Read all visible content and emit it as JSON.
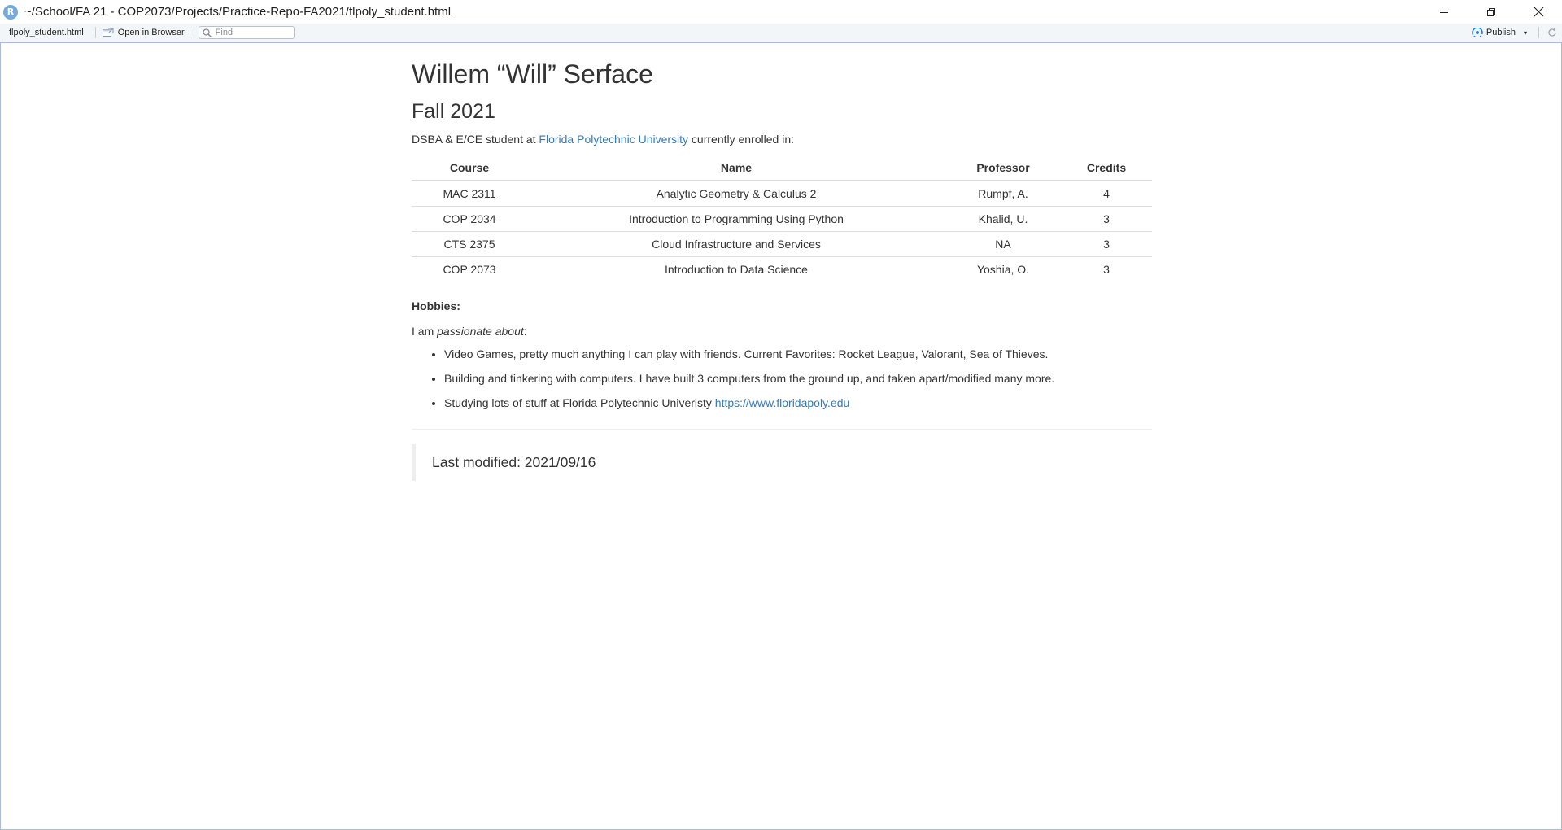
{
  "window": {
    "app_icon_letter": "R",
    "title": "~/School/FA 21 - COP2073/Projects/Practice-Repo-FA2021/flpoly_student.html",
    "controls": {
      "minimize_icon": "minimize-icon",
      "restore_icon": "restore-icon",
      "close_icon": "close-icon"
    }
  },
  "toolbar": {
    "filename": "flpoly_student.html",
    "open_in_browser_label": "Open in Browser",
    "find_placeholder": "Find",
    "publish_label": "Publish",
    "publish_caret": "▾"
  },
  "document": {
    "title": "Willem “Will” Serface",
    "subtitle": "Fall 2021",
    "intro_prefix": "DSBA & E/CE student at ",
    "intro_link": "Florida Polytechnic University",
    "intro_suffix": " currently enrolled in:",
    "table": {
      "headers": [
        "Course",
        "Name",
        "Professor",
        "Credits"
      ],
      "rows": [
        [
          "MAC 2311",
          "Analytic Geometry & Calculus 2",
          "Rumpf, A.",
          "4"
        ],
        [
          "COP 2034",
          "Introduction to Programming Using Python",
          "Khalid, U.",
          "3"
        ],
        [
          "CTS 2375",
          "Cloud Infrastructure and Services",
          "NA",
          "3"
        ],
        [
          "COP 2073",
          "Introduction to Data Science",
          "Yoshia, O.",
          "3"
        ]
      ]
    },
    "hobbies_title": "Hobbies:",
    "passion_prefix": "I am ",
    "passion_emphasis": "passionate about",
    "passion_suffix": ":",
    "hobbies": [
      {
        "text": "Video Games, pretty much anything I can play with friends. Current Favorites: Rocket League, Valorant, Sea of Thieves.",
        "link": ""
      },
      {
        "text": "Building and tinkering with computers. I have built 3 computers from the ground up, and taken apart/modified many more.",
        "link": ""
      },
      {
        "text": "Studying lots of stuff at Florida Polytechnic Univeristy ",
        "link": "https://www.floridapoly.edu"
      }
    ],
    "last_modified": "Last modified: 2021/09/16"
  },
  "colors": {
    "link": "#337ab7",
    "text": "#333333",
    "app_icon": "#75aadb",
    "toolbar_bg": "#f3f6f8",
    "viewer_border": "#a8bcd6"
  }
}
